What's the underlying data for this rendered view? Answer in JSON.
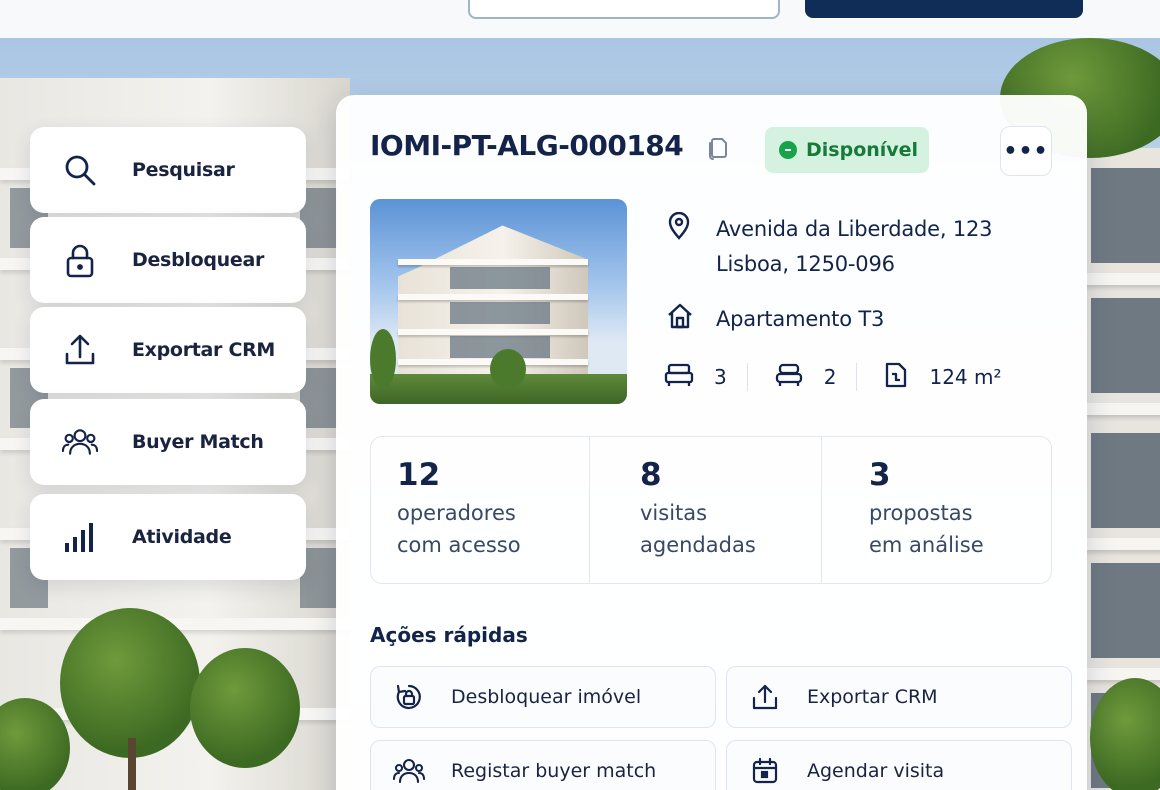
{
  "sidebar": {
    "items": [
      {
        "label": "Pesquisar",
        "icon": "search-icon"
      },
      {
        "label": "Desbloquear",
        "icon": "lock-icon"
      },
      {
        "label": "Exportar CRM",
        "icon": "upload-icon"
      },
      {
        "label": "Buyer Match",
        "icon": "users-icon"
      },
      {
        "label": "Atividade",
        "icon": "bar-chart-icon"
      }
    ]
  },
  "property": {
    "id": "IOMI-PT-ALG-000184",
    "status": "Disponível",
    "status_color": "#16a34a",
    "address_line1": "Avenida da Liberdade, 123",
    "address_line2": "Lisboa, 1250-096",
    "type": "Apartamento T3",
    "bedrooms": "3",
    "bathrooms": "2",
    "area": "124 m²"
  },
  "stats": [
    {
      "value": "12",
      "line1": "operadores",
      "line2": "com acesso"
    },
    {
      "value": "8",
      "line1": "visitas",
      "line2": "agendadas"
    },
    {
      "value": "3",
      "line1": "propostas",
      "line2": "em análise"
    }
  ],
  "quick_actions": {
    "title": "Ações rápidas",
    "items": [
      {
        "label": "Desbloquear imóvel",
        "icon": "unlock-icon"
      },
      {
        "label": "Exportar CRM",
        "icon": "export-icon"
      },
      {
        "label": "Registar buyer match",
        "icon": "users-icon"
      },
      {
        "label": "Agendar visita",
        "icon": "calendar-icon"
      }
    ]
  },
  "colors": {
    "primary": "#14234a",
    "accent_dark": "#0f2d57",
    "badge_bg": "#d4f2df"
  }
}
